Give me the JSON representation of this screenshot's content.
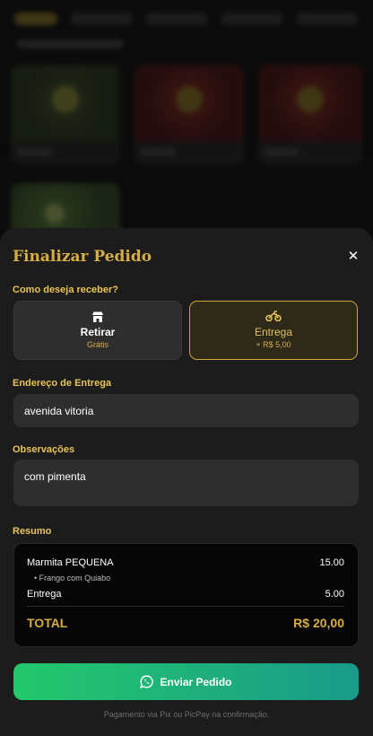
{
  "sheet": {
    "title": "Finalizar Pedido",
    "close_symbol": "✕",
    "delivery_question": "Como deseja receber?",
    "options": [
      {
        "name": "Retirar",
        "sub": "Grátis",
        "icon": "store-icon",
        "selected": false
      },
      {
        "name": "Entrega",
        "sub": "+ R$ 5,00",
        "icon": "motorcycle-icon",
        "selected": true
      }
    ],
    "address_label": "Endereço de Entrega",
    "address_value": "avenida vitoria",
    "notes_label": "Observações",
    "notes_value": "com pimenta",
    "summary_label": "Resumo",
    "summary": {
      "item_name": "Marmita PEQUENA",
      "item_price": "15.00",
      "item_detail": "• Frango com Quiabo",
      "delivery_name": "Entrega",
      "delivery_price": "5.00",
      "total_label": "TOTAL",
      "total_value": "R$ 20,00"
    },
    "send_label": "Enviar Pedido",
    "footnote": "Pagamento via Pix ou PicPay na confirmação."
  },
  "colors": {
    "accent": "#d6ae45",
    "send_gradient_start": "#23c86b",
    "send_gradient_end": "#1a9a8a",
    "sheet_bg": "#1c1c1c"
  }
}
